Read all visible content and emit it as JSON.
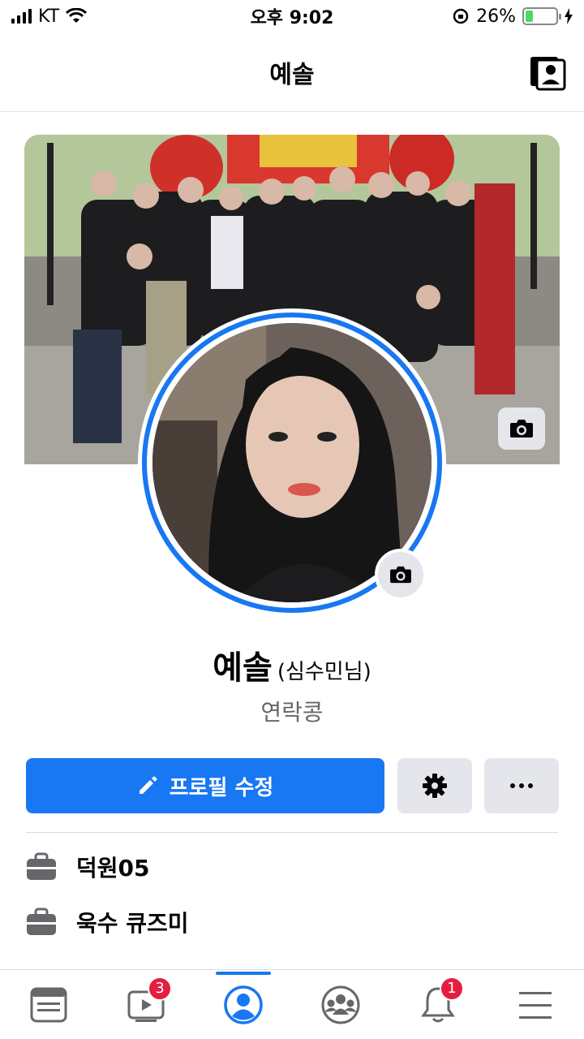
{
  "status_bar": {
    "carrier": "KT",
    "time": "오후 9:02",
    "battery_percent": "26%",
    "battery_level": 0.26
  },
  "header": {
    "title": "예솔",
    "icon": "contact-card-icon"
  },
  "profile": {
    "name": "예솔",
    "alt_name": "(심수민님)",
    "nickname": "연락콩",
    "ring_color": "#1877f2"
  },
  "actions": {
    "edit_label": "프로필 수정",
    "settings_icon": "gear-icon",
    "more_icon": "more-icon"
  },
  "info": [
    {
      "icon": "briefcase-icon",
      "text": "덕원05"
    },
    {
      "icon": "briefcase-icon",
      "text": "욱수 큐즈미"
    }
  ],
  "bottom_nav": {
    "items": [
      {
        "icon": "news-feed-icon",
        "badge": ""
      },
      {
        "icon": "video-icon",
        "badge": "3"
      },
      {
        "icon": "profile-icon",
        "badge": "",
        "active": true
      },
      {
        "icon": "groups-icon",
        "badge": ""
      },
      {
        "icon": "bell-icon",
        "badge": "1"
      },
      {
        "icon": "menu-icon",
        "badge": ""
      }
    ]
  },
  "colors": {
    "accent": "#1877f2",
    "badge": "#e41e3f",
    "button_gray": "#e4e6eb"
  }
}
